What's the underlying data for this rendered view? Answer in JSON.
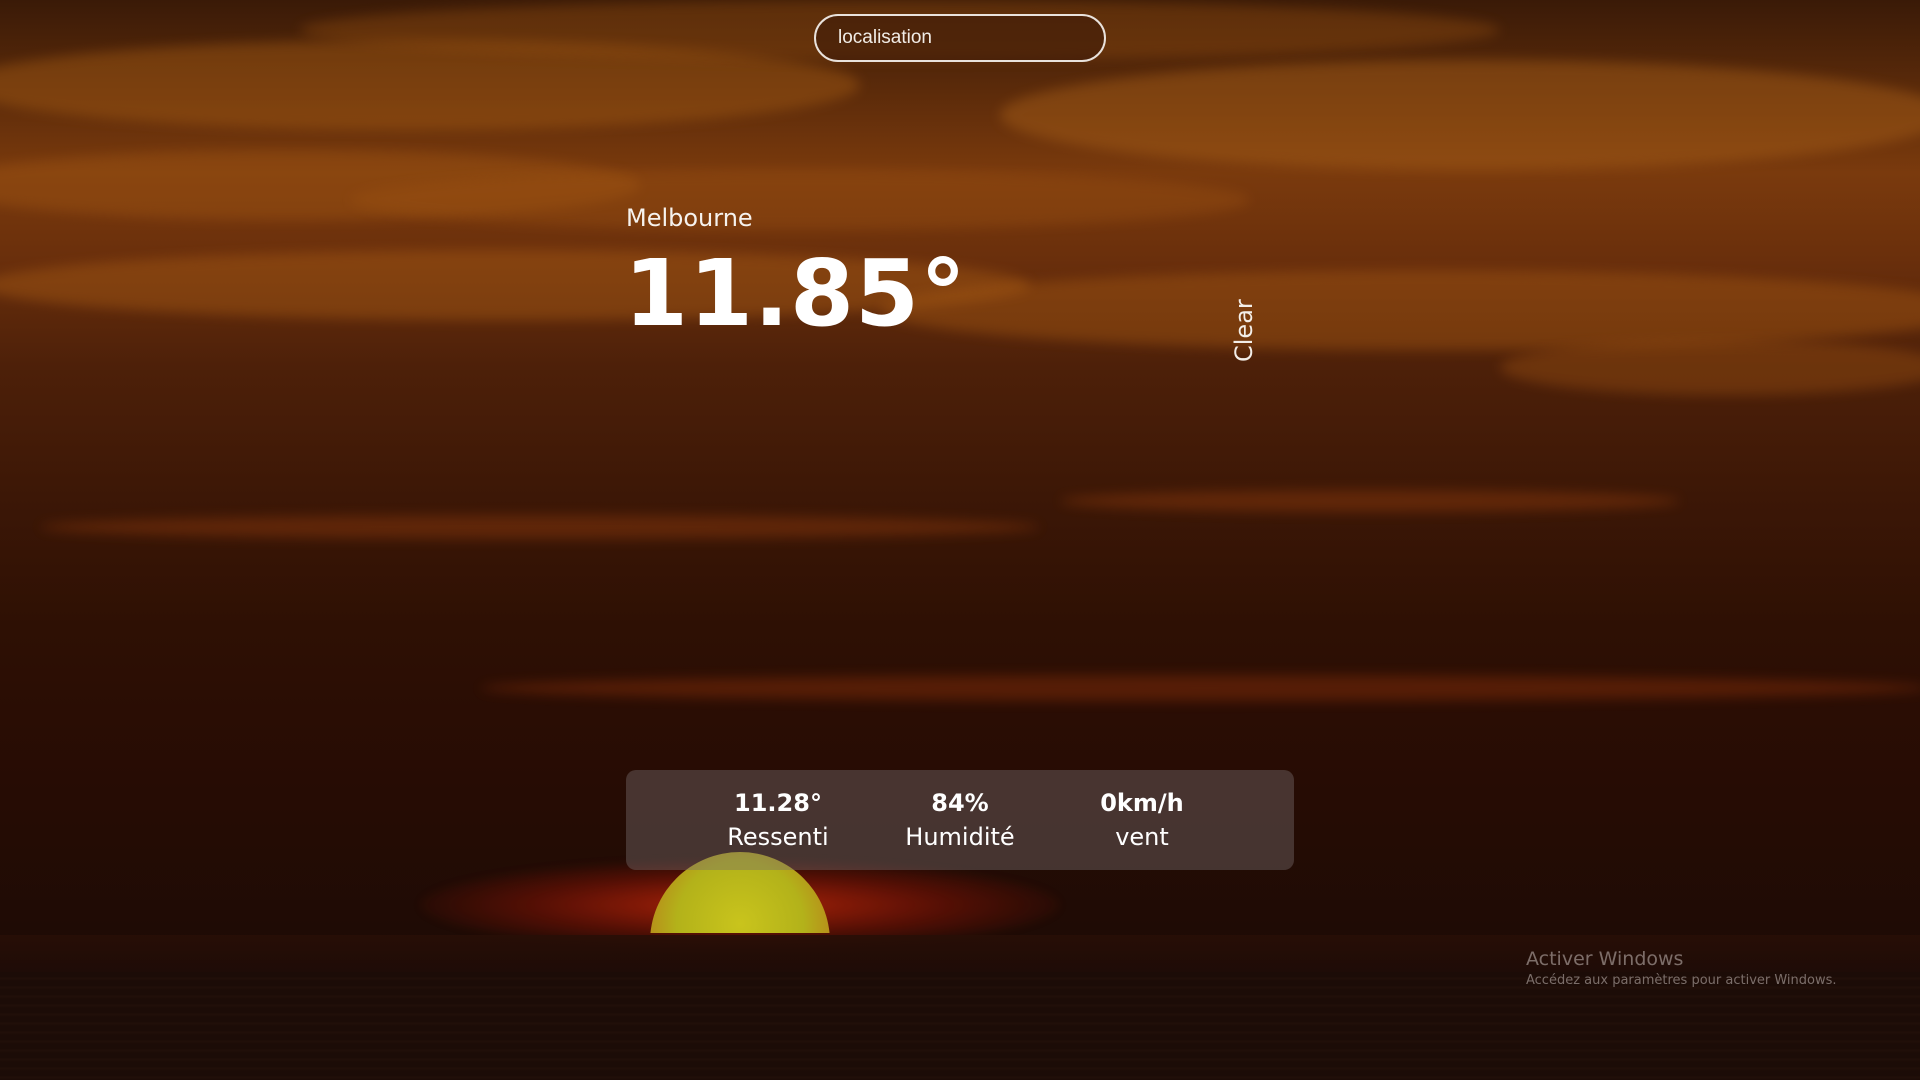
{
  "search": {
    "placeholder": "localisation"
  },
  "weather": {
    "city": "Melbourne",
    "temperature": "11.85°",
    "condition": "Clear"
  },
  "stats": [
    {
      "value": "11.28°",
      "label": "Ressenti"
    },
    {
      "value": "84%",
      "label": "Humidité"
    },
    {
      "value": "0km/h",
      "label": "vent"
    }
  ],
  "watermark": {
    "title": "Activer Windows",
    "subtitle": "Accédez aux paramètres pour activer Windows."
  },
  "colors": {
    "sky_top": "#5a2a0a",
    "sky_bottom": "#1f0b05",
    "sun": "#c9c41c",
    "text": "#ffffff"
  }
}
